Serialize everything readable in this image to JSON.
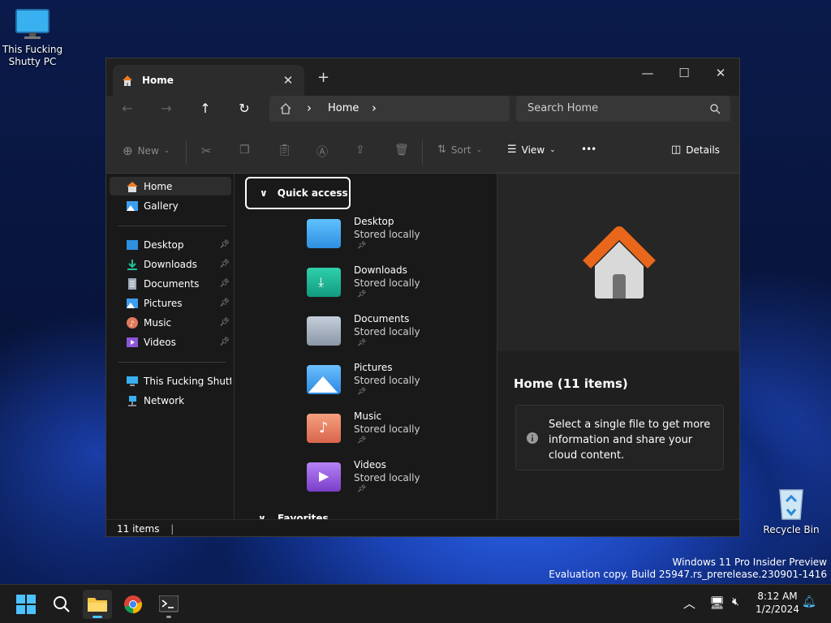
{
  "desktop": {
    "pc_label": "This Fucking Shutty PC",
    "recycle_label": "Recycle Bin",
    "watermark_line1": "Windows 11 Pro Insider Preview",
    "watermark_line2": "Evaluation copy. Build 25947.rs_prerelease.230901-1416"
  },
  "window": {
    "tab_title": "Home",
    "tab_close": "✕",
    "new_tab": "+",
    "minimize": "—",
    "maximize": "☐",
    "close": "✕"
  },
  "address": {
    "back": "←",
    "forward": "→",
    "up": "↑",
    "refresh": "↻",
    "crumb_sep": "›",
    "crumb": "Home",
    "search_placeholder": "Search Home"
  },
  "commands": {
    "new": "New",
    "sort": "Sort",
    "view": "View",
    "more": "•••",
    "details": "Details"
  },
  "nav": {
    "top": [
      {
        "label": "Home",
        "icon": "home-icon"
      },
      {
        "label": "Gallery",
        "icon": "gallery-icon"
      }
    ],
    "pinned": [
      {
        "label": "Desktop",
        "icon": "desktop-icon"
      },
      {
        "label": "Downloads",
        "icon": "downloads-icon"
      },
      {
        "label": "Documents",
        "icon": "documents-icon"
      },
      {
        "label": "Pictures",
        "icon": "pictures-icon"
      },
      {
        "label": "Music",
        "icon": "music-icon"
      },
      {
        "label": "Videos",
        "icon": "videos-icon"
      }
    ],
    "bottom": [
      {
        "label": "This Fucking Shutty I",
        "icon": "pc-icon"
      },
      {
        "label": "Network",
        "icon": "network-icon"
      }
    ]
  },
  "quick_access": {
    "header": "Quick access",
    "items": [
      {
        "name": "Desktop",
        "sub": "Stored locally",
        "color": "#2f8fe0"
      },
      {
        "name": "Downloads",
        "sub": "Stored locally",
        "color": "#1aa890"
      },
      {
        "name": "Documents",
        "sub": "Stored locally",
        "color": "#8b97a8"
      },
      {
        "name": "Pictures",
        "sub": "Stored locally",
        "color": "#3d9ef0"
      },
      {
        "name": "Music",
        "sub": "Stored locally",
        "color": "#e07a5a"
      },
      {
        "name": "Videos",
        "sub": "Stored locally",
        "color": "#8e55d8"
      }
    ],
    "next_group": "Favorites"
  },
  "details_pane": {
    "title": "Home (11 items)",
    "info": "Select a single file to get more information and share your cloud content."
  },
  "status": {
    "count": "11 items"
  },
  "taskbar": {
    "time": "8:12 AM",
    "date": "1/2/2024"
  }
}
